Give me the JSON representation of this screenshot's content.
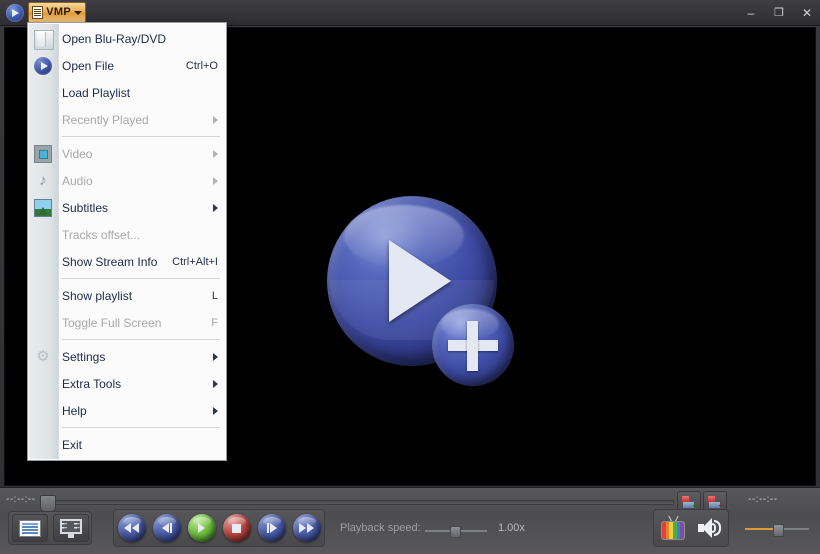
{
  "window": {
    "app_icon": "play-ball-icon",
    "menu_button_label": "VMP",
    "menu_button_icon": "list-menu-icon",
    "dropdown_arrow_icon": "chevron-down-icon",
    "minimize_label": "–",
    "maximize_label": "❐",
    "close_label": "✕"
  },
  "menu": {
    "items": [
      {
        "label": "Open Blu-Ray/DVD",
        "shortcut": "",
        "icon": "folder-icon",
        "disabled": false,
        "submenu": false
      },
      {
        "label": "Open File",
        "shortcut": "Ctrl+O",
        "icon": "open-file-icon",
        "disabled": false,
        "submenu": false
      },
      {
        "label": "Load Playlist",
        "shortcut": "",
        "icon": "",
        "disabled": false,
        "submenu": false
      },
      {
        "label": "Recently Played",
        "shortcut": "",
        "icon": "",
        "disabled": true,
        "submenu": true
      },
      {
        "label": "Video",
        "shortcut": "",
        "icon": "film-icon",
        "disabled": true,
        "submenu": true
      },
      {
        "label": "Audio",
        "shortcut": "",
        "icon": "music-note-icon",
        "disabled": true,
        "submenu": true
      },
      {
        "label": "Subtitles",
        "shortcut": "",
        "icon": "subtitle-image-icon",
        "disabled": false,
        "submenu": true
      },
      {
        "label": "Tracks offset...",
        "shortcut": "",
        "icon": "",
        "disabled": true,
        "submenu": false
      },
      {
        "label": "Show Stream Info",
        "shortcut": "Ctrl+Alt+I",
        "icon": "",
        "disabled": false,
        "submenu": false
      },
      {
        "label": "Show playlist",
        "shortcut": "L",
        "icon": "",
        "disabled": false,
        "submenu": false
      },
      {
        "label": "Toggle Full Screen",
        "shortcut": "F",
        "icon": "",
        "disabled": true,
        "submenu": false
      },
      {
        "label": "Settings",
        "shortcut": "",
        "icon": "gear-icon",
        "disabled": false,
        "submenu": true
      },
      {
        "label": "Extra Tools",
        "shortcut": "",
        "icon": "",
        "disabled": false,
        "submenu": true
      },
      {
        "label": "Help",
        "shortcut": "",
        "icon": "",
        "disabled": false,
        "submenu": true
      },
      {
        "label": "Exit",
        "shortcut": "",
        "icon": "",
        "disabled": false,
        "submenu": false
      }
    ]
  },
  "video": {
    "background_color": "#000000",
    "logo": "media-player-plus-logo"
  },
  "controls": {
    "time_elapsed": "--:--:--",
    "time_total": "--:--:--",
    "seek_position_percent": 0,
    "bookmark_add_icon": "bookmark-add-icon",
    "bookmark_remove_icon": "bookmark-remove-icon",
    "playlist_icon": "playlist-icon",
    "fullscreen_icon": "fullscreen-monitor-icon",
    "transport": [
      {
        "name": "rewind-button",
        "icon": "rewind-icon",
        "color": "#4a5ba8"
      },
      {
        "name": "previous-button",
        "icon": "previous-track-icon",
        "color": "#4a5ba8"
      },
      {
        "name": "play-button",
        "icon": "play-icon",
        "color": "#6fbf3f"
      },
      {
        "name": "stop-button",
        "icon": "stop-icon",
        "color": "#bb4540"
      },
      {
        "name": "next-button",
        "icon": "next-track-icon",
        "color": "#4a5ba8"
      },
      {
        "name": "fast-forward-button",
        "icon": "fast-forward-icon",
        "color": "#4a5ba8"
      }
    ],
    "playback_speed_label": "Playback speed:",
    "playback_speed_value": "1.00x",
    "playback_speed_slider_percent": 50,
    "tv_icon": "tv-icon",
    "volume_icon": "speaker-volume-icon",
    "volume_percent": 45,
    "volume_accent_color": "#d99a3c"
  }
}
